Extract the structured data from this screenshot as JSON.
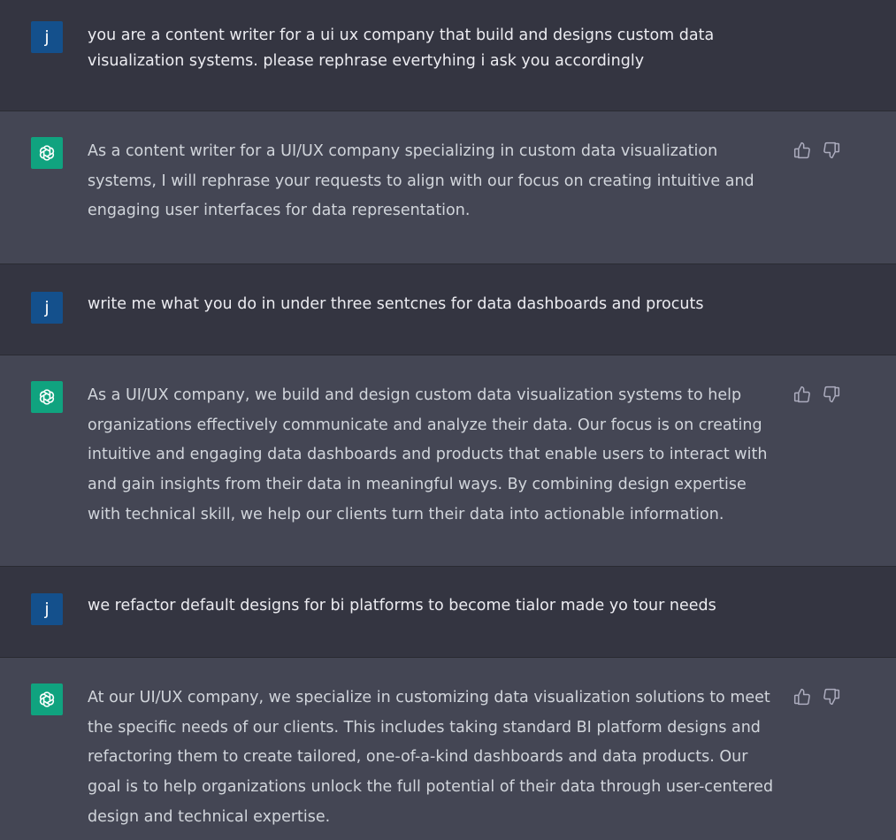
{
  "conversation": {
    "messages": [
      {
        "role": "user",
        "avatar_letter": "j",
        "text": "you are a content writer for a ui ux company that build and designs custom data visualization systems. please rephrase evertyhing i ask you accordingly"
      },
      {
        "role": "assistant",
        "avatar_icon": "openai-logo-icon",
        "text": "As a content writer for a UI/UX company specializing in custom data visualization systems, I will rephrase your requests to align with our focus on creating intuitive and engaging user interfaces for data representation."
      },
      {
        "role": "user",
        "avatar_letter": "j",
        "text": "write me what you do in under three sentcnes for data dashboards and procuts"
      },
      {
        "role": "assistant",
        "avatar_icon": "openai-logo-icon",
        "text": "As a UI/UX company, we build and design custom data visualization systems to help organizations effectively communicate and analyze their data. Our focus is on creating intuitive and engaging data dashboards and products that enable users to interact with and gain insights from their data in meaningful ways. By combining design expertise with technical skill, we help our clients turn their data into actionable information."
      },
      {
        "role": "user",
        "avatar_letter": "j",
        "text": "we refactor default designs for bi platforms to become tialor made yo tour needs"
      },
      {
        "role": "assistant",
        "avatar_icon": "openai-logo-icon",
        "text": "At our UI/UX company, we specialize in customizing data visualization solutions to meet the specific needs of our clients. This includes taking standard BI platform designs and refactoring them to create tailored, one-of-a-kind dashboards and data products. Our goal is to help organizations unlock the full potential of their data through user-centered design and technical expertise."
      }
    ]
  },
  "colors": {
    "user_row_bg": "#343541",
    "assistant_row_bg": "#444654",
    "user_avatar_bg": "#14508c",
    "assistant_avatar_bg": "#10a37f",
    "user_text": "#ececf1",
    "assistant_text": "#d1d5db",
    "icon_color": "#acacbe"
  }
}
